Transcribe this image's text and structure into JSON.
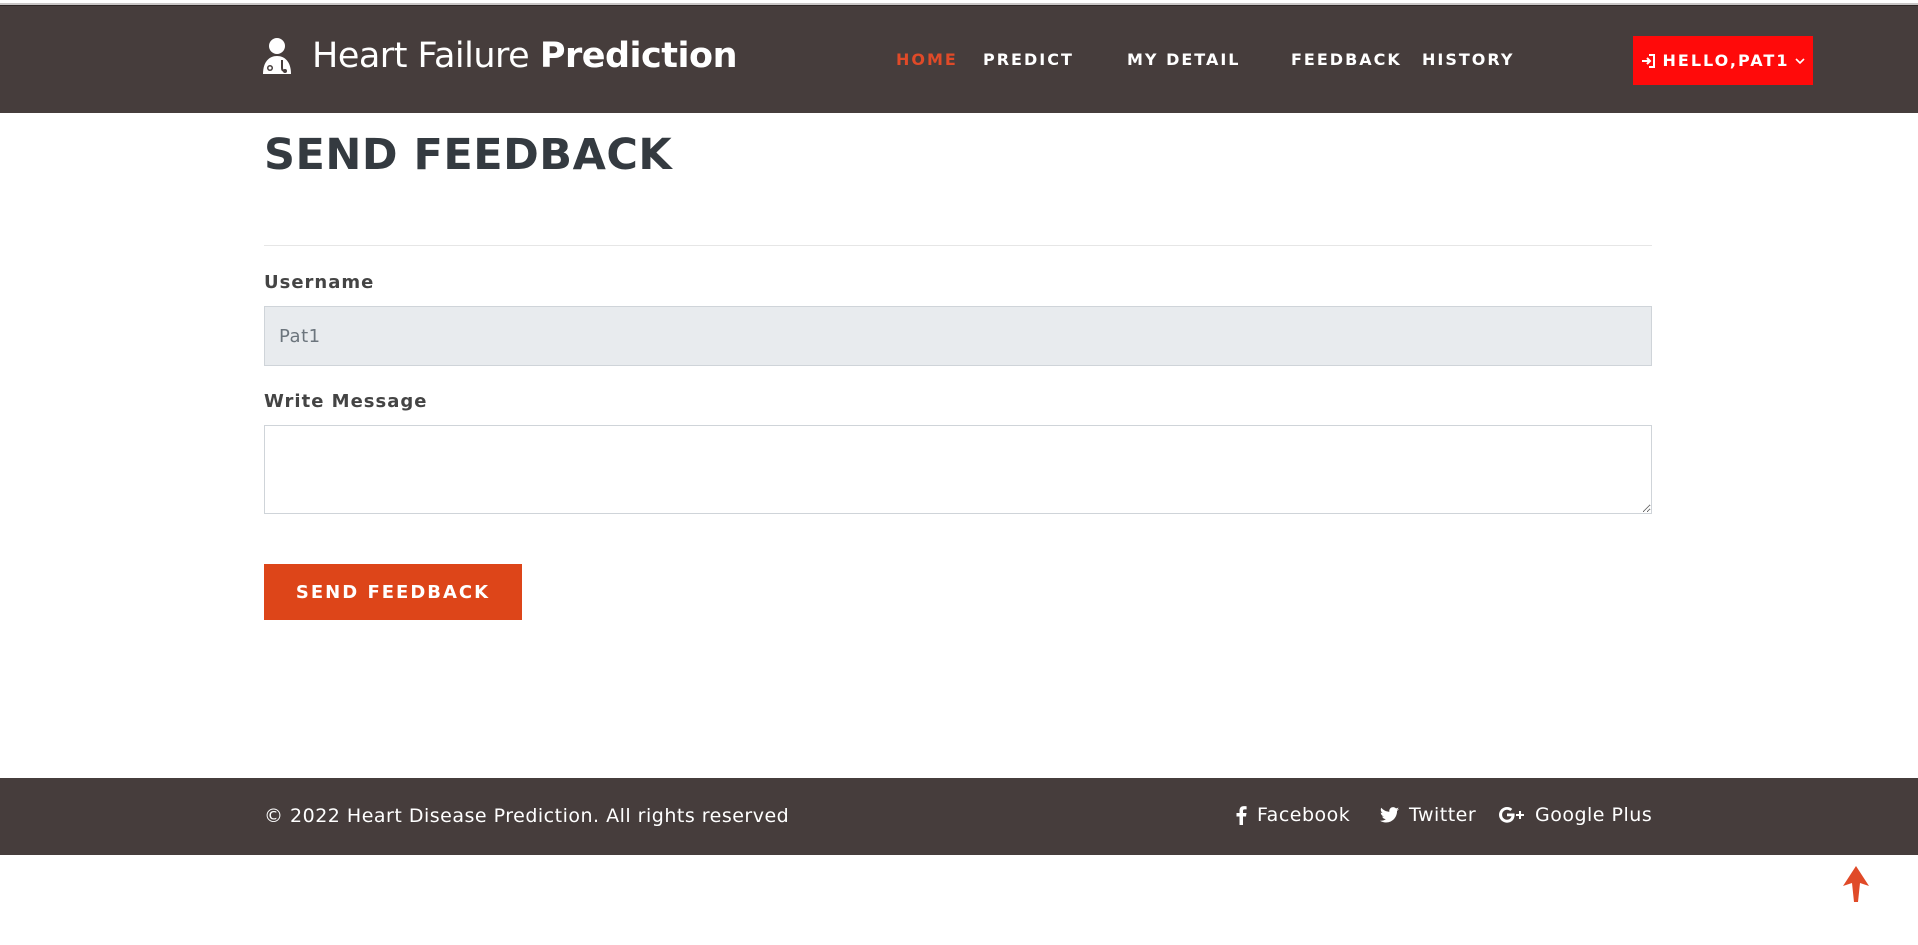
{
  "header": {
    "brand_light": "Heart Failure",
    "brand_bold": "Prediction",
    "logo_icon": "doctor-icon",
    "nav": [
      {
        "label": "HOME",
        "active": true
      },
      {
        "label": "PREDICT",
        "active": false
      },
      {
        "label": "MY DETAIL",
        "active": false
      },
      {
        "label": "FEEDBACK",
        "active": false
      },
      {
        "label": "HISTORY",
        "active": false
      }
    ],
    "user_button": {
      "label": "HELLO,PAT1",
      "icon": "login-icon",
      "caret": "chevron-down-icon"
    }
  },
  "main": {
    "title": "SEND FEEDBACK",
    "username_label": "Username",
    "username_value": "Pat1",
    "message_label": "Write Message",
    "message_value": "",
    "submit_label": "SEND FEEDBACK"
  },
  "footer": {
    "copyright": "© 2022 Heart Disease Prediction. All rights reserved",
    "social": [
      {
        "label": "Facebook",
        "icon": "facebook-icon"
      },
      {
        "label": "Twitter",
        "icon": "twitter-icon"
      },
      {
        "label": "Google Plus",
        "icon": "google-plus-icon"
      }
    ]
  },
  "colors": {
    "header_bg": "#463d3c",
    "accent": "#dd4519",
    "user_button_bg": "#ff0a0a",
    "active_nav": "#e04a28"
  },
  "back_to_top_icon": "arrow-up-icon"
}
